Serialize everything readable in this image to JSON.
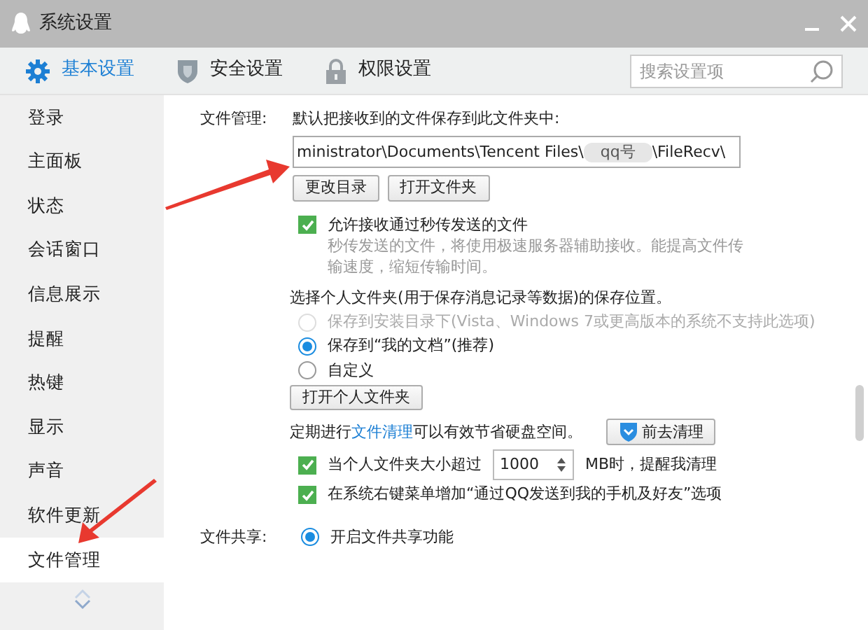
{
  "window": {
    "title": "系统设置"
  },
  "tabs": [
    {
      "label": "基本设置",
      "selected": true,
      "kind": "gear"
    },
    {
      "label": "安全设置",
      "selected": false,
      "kind": "shield"
    },
    {
      "label": "权限设置",
      "selected": false,
      "kind": "lock"
    }
  ],
  "search": {
    "placeholder": "搜索设置项"
  },
  "sidebar": {
    "items": [
      {
        "label": "登录",
        "selected": false
      },
      {
        "label": "主面板",
        "selected": false
      },
      {
        "label": "状态",
        "selected": false
      },
      {
        "label": "会话窗口",
        "selected": false
      },
      {
        "label": "信息展示",
        "selected": false
      },
      {
        "label": "提醒",
        "selected": false
      },
      {
        "label": "热键",
        "selected": false
      },
      {
        "label": "显示",
        "selected": false
      },
      {
        "label": "声音",
        "selected": false
      },
      {
        "label": "软件更新",
        "selected": false
      },
      {
        "label": "文件管理",
        "selected": true
      }
    ]
  },
  "file_management": {
    "label": "文件管理:",
    "prompt": "默认把接收到的文件保存到此文件夹中:",
    "path_before": "ministrator\\Documents\\Tencent Files\\",
    "path_blurred": "qq号",
    "path_after": "\\FileRecv\\",
    "buttons": [
      "更改目录",
      "打开文件夹"
    ],
    "receive_option": {
      "label": "允许接收通过秒传发送的文件",
      "checked": true,
      "hint": "秒传发送的文件，将使用极速服务器辅助接收。能提高文件传输速度，缩短传输时间。"
    },
    "personal_folder": {
      "prompt": "选择个人文件夹(用于保存消息记录等数据)的保存位置。",
      "options": [
        {
          "label": "保存到安装目录下(Vista、Windows 7或更高版本的系统不支持此选项)",
          "selected": false,
          "disabled": true
        },
        {
          "label": "保存到“我的文档”(推荐)",
          "selected": true,
          "disabled": false
        },
        {
          "label": "自定义",
          "selected": false,
          "disabled": false
        }
      ],
      "button": "打开个人文件夹"
    },
    "cleanup": {
      "text_before": "定期进行",
      "link": "文件清理",
      "text_after": "可以有效节省硬盘空间。",
      "button": "前去清理"
    },
    "size_alert": {
      "label_before": "当个人文件夹大小超过",
      "value": "1000",
      "label_after": "MB时，提醒我清理",
      "checked": true
    },
    "context_menu": {
      "label": "在系统右键菜单增加“通过QQ发送到我的手机及好友”选项",
      "checked": true
    }
  },
  "file_sharing": {
    "label": "文件共享:",
    "options": [
      {
        "label": "开启文件共享功能",
        "selected": true
      }
    ]
  }
}
